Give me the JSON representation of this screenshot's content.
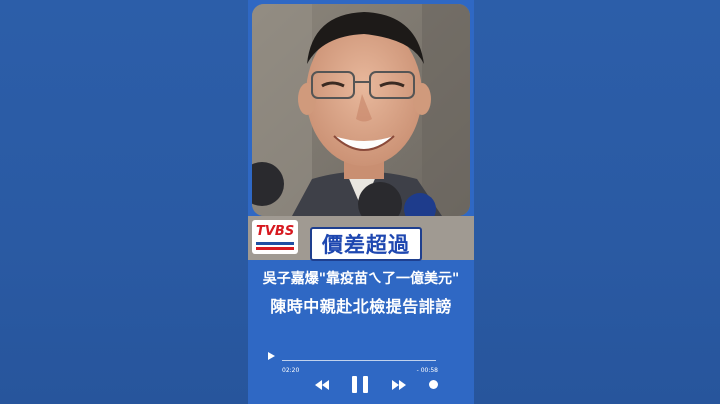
{
  "news": {
    "badge": "價差超過",
    "headline1": "吳子嘉爆\"靠疫苗ㄟ了一億美元\"",
    "headline2": "陳時中親赴北檢提告誹謗",
    "logo": "TVBS"
  },
  "player": {
    "elapsed": "02:20",
    "remaining": "- 00:58"
  },
  "colors": {
    "background": "#2a5ba6",
    "panel": "#2f68c4",
    "badge_text": "#1e47b0"
  }
}
